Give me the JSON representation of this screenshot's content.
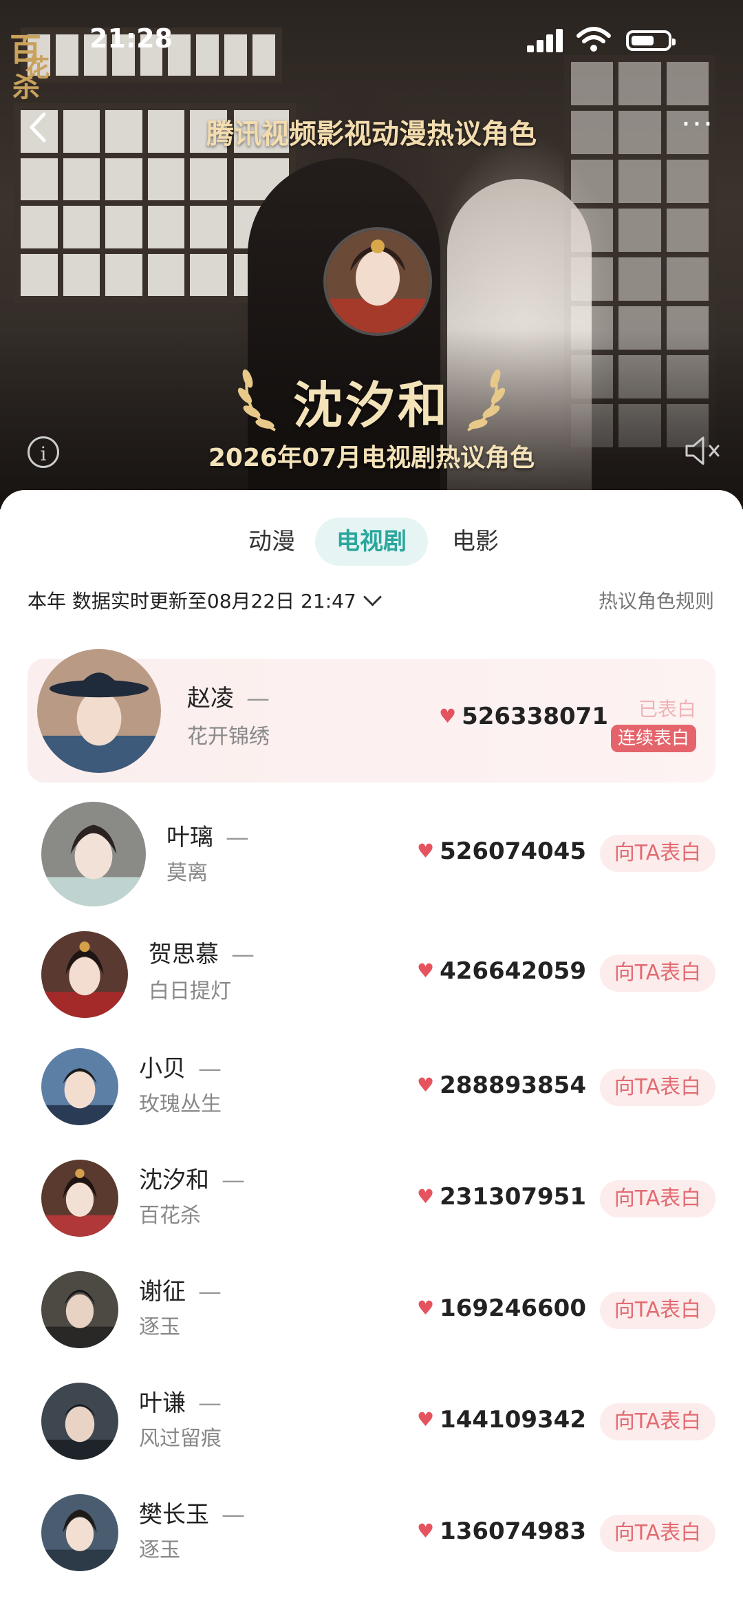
{
  "status_bar": {
    "time": "21:28"
  },
  "hero": {
    "logo_text": [
      "百",
      "花",
      "杀"
    ],
    "title": "腾讯视频影视动漫热议角色",
    "more": "···",
    "winner_name": "沈汐和",
    "winner_subtitle": "2026年07月电视剧热议角色",
    "info": "i"
  },
  "tabs": [
    {
      "label": "动漫",
      "active": false
    },
    {
      "label": "电视剧",
      "active": true
    },
    {
      "label": "电影",
      "active": false
    }
  ],
  "filter": {
    "text": "本年  数据实时更新至08月22日 21:47"
  },
  "rules_label": "热议角色规则",
  "dash": "—",
  "list": [
    {
      "name": "赵凌",
      "drama": "花开锦绣",
      "score": "526338071",
      "status": "已表白",
      "badge": "连续表白",
      "color": "#3d5a7a"
    },
    {
      "name": "叶璃",
      "drama": "莫离",
      "score": "526074045",
      "button": "向TA表白",
      "color": "#8a8a86"
    },
    {
      "name": "贺思慕",
      "drama": "白日提灯",
      "score": "426642059",
      "button": "向TA表白",
      "color": "#8a2a2a"
    },
    {
      "name": "小贝",
      "drama": "玫瑰丛生",
      "score": "288893854",
      "button": "向TA表白",
      "color": "#5c7fa6"
    },
    {
      "name": "沈汐和",
      "drama": "百花杀",
      "score": "231307951",
      "button": "向TA表白",
      "color": "#7a2f2f"
    },
    {
      "name": "谢征",
      "drama": "逐玉",
      "score": "169246600",
      "button": "向TA表白",
      "color": "#4d4a44"
    },
    {
      "name": "叶谦",
      "drama": "风过留痕",
      "score": "144109342",
      "button": "向TA表白",
      "color": "#3e4650"
    },
    {
      "name": "樊长玉",
      "drama": "逐玉",
      "score": "136074983",
      "button": "向TA表白",
      "color": "#4a5d70"
    }
  ],
  "colors": {
    "accent_teal": "#2aa79d",
    "heart_red": "#e5535e",
    "gold": "#f4e2b9"
  }
}
